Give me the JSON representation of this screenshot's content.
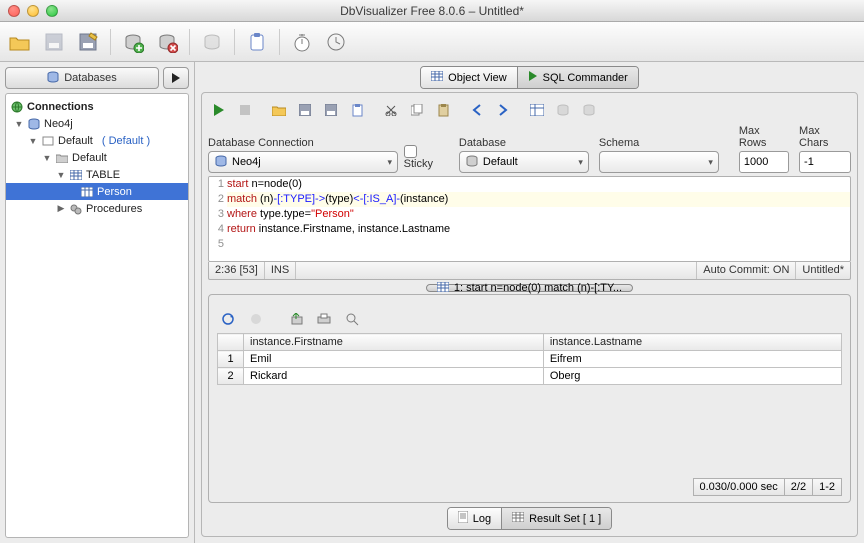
{
  "window": {
    "title": "DbVisualizer Free 8.0.6 – Untitled*"
  },
  "sidebar": {
    "tab_label": "Databases",
    "tree": {
      "root": "Connections",
      "conn": "Neo4j",
      "default_schema": "Default",
      "default_marker": "( Default )",
      "default2": "Default",
      "table_folder": "TABLE",
      "table_item": "Person",
      "procedures": "Procedures"
    }
  },
  "tabs": {
    "object_view": "Object View",
    "sql_commander": "SQL Commander"
  },
  "conn": {
    "db_conn_label": "Database Connection",
    "sticky_label": "Sticky",
    "db_label": "Database",
    "schema_label": "Schema",
    "maxrows_label": "Max Rows",
    "maxchars_label": "Max Chars",
    "db_conn_value": "Neo4j",
    "db_value": "Default",
    "schema_value": "",
    "maxrows_value": "1000",
    "maxchars_value": "-1"
  },
  "editor": {
    "lines": {
      "l1": {
        "kw": "start",
        "rest": " n=node(0)"
      },
      "l2": {
        "kw": "match",
        "sp": " ",
        "p1": "(n)",
        "b1": "-[:TYPE]->",
        "p2": "(type)",
        "b2": "<-[:IS_A]-",
        "p3": "(instance)"
      },
      "l3": {
        "kw": "where",
        "rest": " type.type=",
        "str": "\"Person\""
      },
      "l4": {
        "kw": "return",
        "rest": " instance.Firstname, instance.Lastname"
      }
    },
    "status_pos": "2:36 [53]",
    "status_ins": "INS",
    "status_autocommit": "Auto Commit: ON",
    "status_file": "Untitled*"
  },
  "result": {
    "tab_label": "1: start n=node(0) match (n)-[:TY...",
    "columns": [
      "instance.Firstname",
      "instance.Lastname"
    ],
    "rows": [
      {
        "n": "1",
        "c0": "Emil",
        "c1": "Eifrem"
      },
      {
        "n": "2",
        "c0": "Rickard",
        "c1": "Oberg"
      }
    ],
    "timing": "0.030/0.000 sec",
    "count": "2/2",
    "range": "1-2"
  },
  "bottom": {
    "log": "Log",
    "result_set": "Result Set [ 1 ]"
  }
}
